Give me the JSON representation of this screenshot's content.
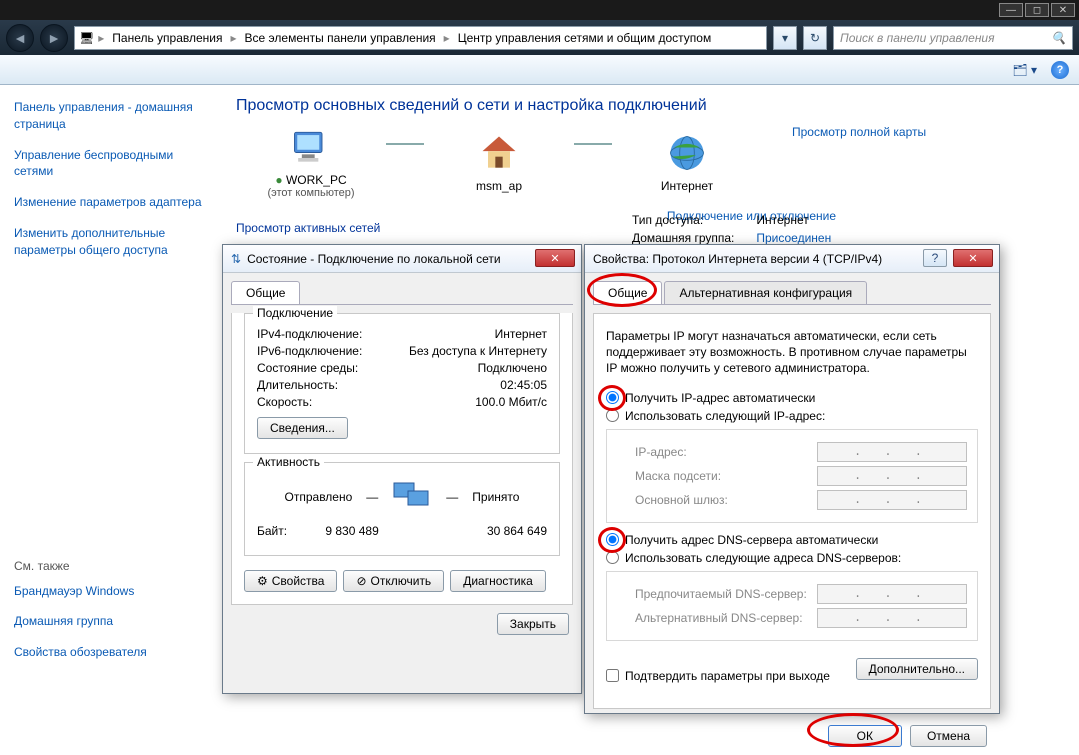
{
  "address": {
    "crumb1": "Панель управления",
    "crumb2": "Все элементы панели управления",
    "crumb3": "Центр управления сетями и общим доступом",
    "search_placeholder": "Поиск в панели управления"
  },
  "sidebar": {
    "home": "Панель управления - домашняя страница",
    "links": [
      "Управление беспроводными сетями",
      "Изменение параметров адаптера",
      "Изменить дополнительные параметры общего доступа"
    ],
    "see_also_label": "См. также",
    "see_also": [
      "Брандмауэр Windows",
      "Домашняя группа",
      "Свойства обозревателя"
    ]
  },
  "content": {
    "heading": "Просмотр основных сведений о сети и настройка подключений",
    "node1": "WORK_PC",
    "node1_sub": "(этот компьютер)",
    "node2": "msm_ap",
    "node3": "Интернет",
    "view_full_map": "Просмотр полной карты",
    "active_networks": "Просмотр активных сетей",
    "connect_disconnect": "Подключение или отключение",
    "network_name": "msm_ap",
    "access_type_label": "Тип доступа:",
    "access_type_value": "Интернет",
    "homegroup_label": "Домашняя группа:",
    "homegroup_value": "Присоединен"
  },
  "status_dialog": {
    "title": "Состояние - Подключение по локальной сети",
    "tab_general": "Общие",
    "group_connection": "Подключение",
    "ipv4_label": "IPv4-подключение:",
    "ipv4_value": "Интернет",
    "ipv6_label": "IPv6-подключение:",
    "ipv6_value": "Без доступа к Интернету",
    "media_label": "Состояние среды:",
    "media_value": "Подключено",
    "duration_label": "Длительность:",
    "duration_value": "02:45:05",
    "speed_label": "Скорость:",
    "speed_value": "100.0 Мбит/c",
    "details_btn": "Сведения...",
    "group_activity": "Активность",
    "sent_label": "Отправлено",
    "received_label": "Принято",
    "bytes_label": "Байт:",
    "sent_value": "9 830 489",
    "received_value": "30 864 649",
    "props_btn": "Свойства",
    "disable_btn": "Отключить",
    "diag_btn": "Диагностика",
    "close_btn": "Закрыть"
  },
  "ipv4_dialog": {
    "title": "Свойства: Протокол Интернета версии 4 (TCP/IPv4)",
    "tab_general": "Общие",
    "tab_alt": "Альтернативная конфигурация",
    "info": "Параметры IP могут назначаться автоматически, если сеть поддерживает эту возможность. В противном случае параметры IP можно получить у сетевого администратора.",
    "radio_ip_auto": "Получить IP-адрес автоматически",
    "radio_ip_manual": "Использовать следующий IP-адрес:",
    "ip_label": "IP-адрес:",
    "mask_label": "Маска подсети:",
    "gw_label": "Основной шлюз:",
    "radio_dns_auto": "Получить адрес DNS-сервера автоматически",
    "radio_dns_manual": "Использовать следующие адреса DNS-серверов:",
    "dns1_label": "Предпочитаемый DNS-сервер:",
    "dns2_label": "Альтернативный DNS-сервер:",
    "chk_validate": "Подтвердить параметры при выходе",
    "advanced_btn": "Дополнительно...",
    "ok_btn": "ОК",
    "cancel_btn": "Отмена"
  }
}
